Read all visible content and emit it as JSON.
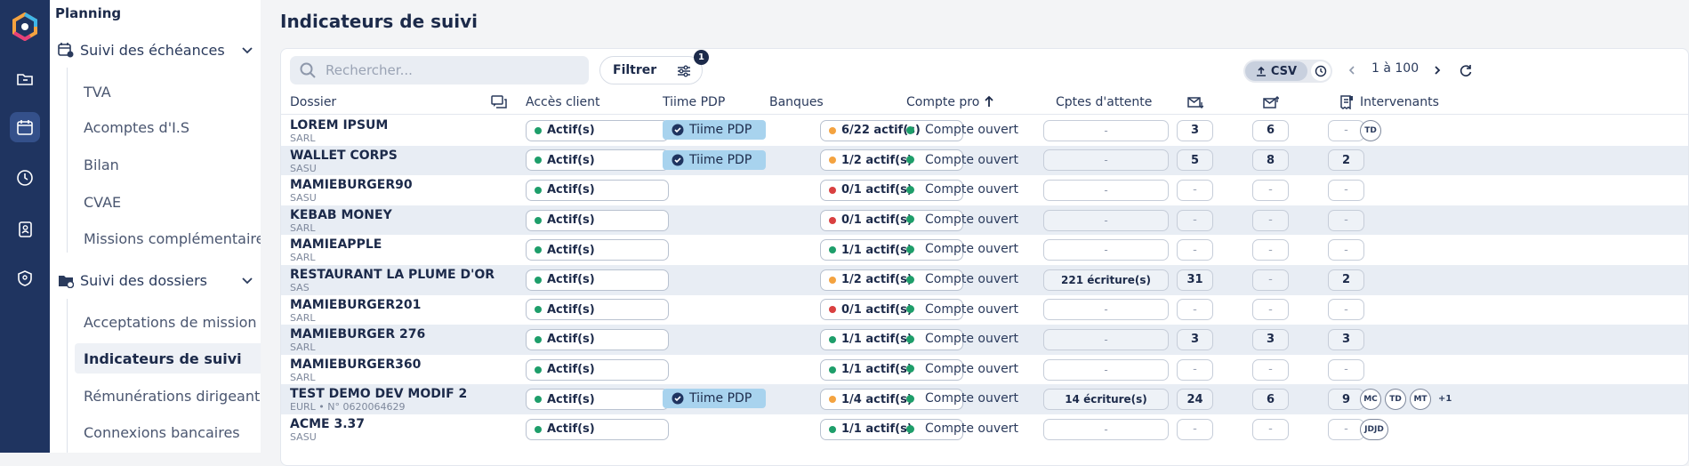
{
  "sidebar": {
    "section_title": "Planning",
    "group1": "Suivi des échéances",
    "group1_items": [
      "TVA",
      "Acomptes d'I.S",
      "Bilan",
      "CVAE",
      "Missions complémentaires"
    ],
    "group2": "Suivi des dossiers",
    "group2_items": [
      "Acceptations de mission",
      "Indicateurs de suivi",
      "Rémunérations dirigeants",
      "Connexions bancaires"
    ]
  },
  "page": {
    "title": "Indicateurs de suivi"
  },
  "toolbar": {
    "search_placeholder": "Rechercher...",
    "filter_label": "Filtrer",
    "filter_badge": "1",
    "csv_label": "CSV",
    "pagination": "1 à 100"
  },
  "columns": {
    "dossier": "Dossier",
    "acces": "Accès client",
    "pdp": "Tiime PDP",
    "banques": "Banques",
    "compte": "Compte pro",
    "attente": "Cptes d'attente",
    "intervenants": "Intervenants"
  },
  "rows": [
    {
      "name": "LOREM IPSUM",
      "sub": "SARL",
      "acces": "Actif(s)",
      "pdp": "Tiime PDP",
      "banques": "6/22 actif(s)",
      "bank_status": "orange",
      "compte": "Compte ouvert",
      "attente": "-",
      "c1": "3",
      "c2": "6",
      "c3": "-",
      "avatars": [
        "TD"
      ],
      "more": ""
    },
    {
      "name": "WALLET CORPS",
      "sub": "SASU",
      "acces": "Actif(s)",
      "pdp": "Tiime PDP",
      "banques": "1/2 actif(s)",
      "bank_status": "orange",
      "compte": "Compte ouvert",
      "attente": "-",
      "c1": "5",
      "c2": "8",
      "c3": "2",
      "avatars": [],
      "more": ""
    },
    {
      "name": "MAMIEBURGER90",
      "sub": "SASU",
      "acces": "Actif(s)",
      "pdp": "",
      "banques": "0/1 actif(s)",
      "bank_status": "red",
      "compte": "Compte ouvert",
      "attente": "-",
      "c1": "-",
      "c2": "-",
      "c3": "-",
      "avatars": [],
      "more": ""
    },
    {
      "name": "KEBAB MONEY",
      "sub": "SARL",
      "acces": "Actif(s)",
      "pdp": "",
      "banques": "0/1 actif(s)",
      "bank_status": "red",
      "compte": "Compte ouvert",
      "attente": "-",
      "c1": "-",
      "c2": "-",
      "c3": "-",
      "avatars": [],
      "more": ""
    },
    {
      "name": "MAMIEAPPLE",
      "sub": "SARL",
      "acces": "Actif(s)",
      "pdp": "",
      "banques": "1/1 actif(s)",
      "bank_status": "green",
      "compte": "Compte ouvert",
      "attente": "-",
      "c1": "-",
      "c2": "-",
      "c3": "-",
      "avatars": [],
      "more": ""
    },
    {
      "name": "RESTAURANT LA PLUME D'OR",
      "sub": "SAS",
      "acces": "Actif(s)",
      "pdp": "",
      "banques": "1/2 actif(s)",
      "bank_status": "orange",
      "compte": "Compte ouvert",
      "attente": "221 écriture(s)",
      "c1": "31",
      "c2": "-",
      "c3": "2",
      "avatars": [],
      "more": ""
    },
    {
      "name": "MAMIEBURGER201",
      "sub": "SARL",
      "acces": "Actif(s)",
      "pdp": "",
      "banques": "0/1 actif(s)",
      "bank_status": "red",
      "compte": "Compte ouvert",
      "attente": "-",
      "c1": "-",
      "c2": "-",
      "c3": "-",
      "avatars": [],
      "more": ""
    },
    {
      "name": "MAMIEBURGER 276",
      "sub": "SARL",
      "acces": "Actif(s)",
      "pdp": "",
      "banques": "1/1 actif(s)",
      "bank_status": "green",
      "compte": "Compte ouvert",
      "attente": "-",
      "c1": "3",
      "c2": "3",
      "c3": "3",
      "avatars": [],
      "more": ""
    },
    {
      "name": "MAMIEBURGER360",
      "sub": "SARL",
      "acces": "Actif(s)",
      "pdp": "",
      "banques": "1/1 actif(s)",
      "bank_status": "green",
      "compte": "Compte ouvert",
      "attente": "-",
      "c1": "-",
      "c2": "-",
      "c3": "-",
      "avatars": [],
      "more": ""
    },
    {
      "name": "TEST DEMO DEV MODIF 2",
      "sub": "EURL • N° 0620064629",
      "acces": "Actif(s)",
      "pdp": "Tiime PDP",
      "banques": "1/4 actif(s)",
      "bank_status": "orange",
      "compte": "Compte ouvert",
      "attente": "14 écriture(s)",
      "c1": "24",
      "c2": "6",
      "c3": "9",
      "avatars": [
        "MC",
        "TD",
        "MT"
      ],
      "more": "+1"
    },
    {
      "name": "ACME 3.37",
      "sub": "SASU",
      "acces": "Actif(s)",
      "pdp": "",
      "banques": "1/1 actif(s)",
      "bank_status": "green",
      "compte": "Compte ouvert",
      "attente": "-",
      "c1": "-",
      "c2": "-",
      "c3": "-",
      "avatars": [
        "JDJD"
      ],
      "more": ""
    }
  ],
  "colors": {
    "green": "#1e9e6a",
    "orange": "#f4a340",
    "red": "#d94040",
    "rail": "#1f3460",
    "pdp": "#a8d3ee"
  }
}
